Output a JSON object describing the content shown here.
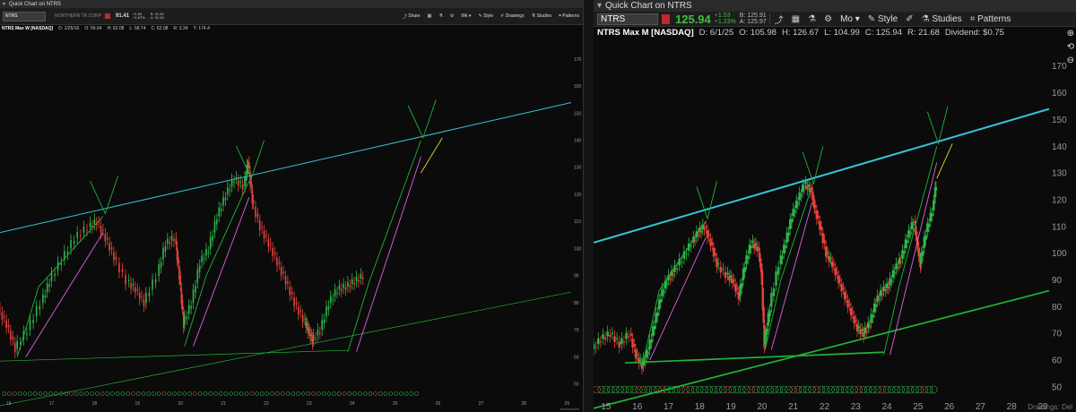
{
  "left": {
    "window_title": "Quick Chart on NTRS",
    "symbol": "NTRS",
    "company": "NORTHERN TR CORP",
    "last_price": "91.41",
    "change_abs": "+1.50",
    "change_pct": "+1.67%",
    "bid": "B: 90.56",
    "ask": "A: 92.38",
    "toolbar": {
      "share": "Share",
      "period": "Wk",
      "style": "Style",
      "drawings": "Drawings",
      "studies": "Studies",
      "patterns": "Patterns"
    },
    "info": {
      "sym": "NTRS Max W [NASDAQ]",
      "date": "D: 1/25/16",
      "open": "O: 59.94",
      "high": "H: 62.08",
      "low": "L: 58.74",
      "close": "C: 62.08",
      "range": "R: 3.34",
      "extra": "Y: 174.4"
    },
    "price_box": "174.4",
    "footer": "thinkorswim",
    "chart_data": {
      "type": "line",
      "x_ticks": [
        "16",
        "17",
        "18",
        "19",
        "20",
        "21",
        "22",
        "23",
        "24",
        "25",
        "26",
        "27",
        "28",
        "29"
      ],
      "y_ticks": [
        "50",
        "60",
        "70",
        "80",
        "90",
        "100",
        "110",
        "120",
        "130",
        "140",
        "150",
        "160",
        "170"
      ],
      "ylim": [
        45,
        178
      ],
      "xlim": [
        15.8,
        29.1
      ],
      "grid": false,
      "series": [
        {
          "values": [
            [
              15.8,
              78
            ],
            [
              16.0,
              72
            ],
            [
              16.2,
              63
            ],
            [
              16.5,
              70
            ],
            [
              16.8,
              80
            ],
            [
              17.0,
              88
            ],
            [
              17.3,
              96
            ],
            [
              17.6,
              104
            ],
            [
              17.9,
              108
            ],
            [
              18.1,
              110
            ],
            [
              18.3,
              104
            ],
            [
              18.5,
              97
            ],
            [
              18.8,
              88
            ],
            [
              19.0,
              85
            ],
            [
              19.2,
              80
            ],
            [
              19.5,
              90
            ],
            [
              19.7,
              102
            ],
            [
              19.9,
              104
            ],
            [
              20.0,
              90
            ],
            [
              20.1,
              72
            ],
            [
              20.3,
              80
            ],
            [
              20.5,
              95
            ],
            [
              20.7,
              100
            ],
            [
              20.9,
              112
            ],
            [
              21.1,
              120
            ],
            [
              21.3,
              126
            ],
            [
              21.5,
              123
            ],
            [
              21.6,
              132
            ],
            [
              21.7,
              118
            ],
            [
              21.9,
              108
            ],
            [
              22.1,
              102
            ],
            [
              22.3,
              95
            ],
            [
              22.5,
              88
            ],
            [
              22.7,
              80
            ],
            [
              22.9,
              74
            ],
            [
              23.0,
              70
            ],
            [
              23.1,
              66
            ],
            [
              23.3,
              70
            ],
            [
              23.5,
              80
            ],
            [
              23.7,
              85
            ],
            [
              23.9,
              86
            ],
            [
              24.1,
              88
            ],
            [
              24.3,
              90
            ]
          ]
        }
      ],
      "top_channel": {
        "x": [
          15.8,
          29.1
        ],
        "y": [
          106,
          154
        ]
      },
      "bottom_channel": {
        "x": [
          15.8,
          29.1
        ],
        "y": [
          42,
          84
        ]
      },
      "flat_support": {
        "x": [
          15.8,
          23.9
        ],
        "y": [
          58.5,
          62.5
        ]
      }
    }
  },
  "right": {
    "window_title": "Quick Chart on NTRS",
    "symbol": "NTRS",
    "last_price": "125.94",
    "change_abs": "+1.53",
    "change_pct": "+1.23%",
    "bid": "B: 125.91",
    "ask": "A: 125.97",
    "toolbar": {
      "period": "Mo",
      "style": "Style",
      "studies": "Studies",
      "patterns": "Patterns"
    },
    "info": {
      "sym": "NTRS Max M [NASDAQ]",
      "date": "D: 6/1/25",
      "open": "O: 105.98",
      "high": "H: 126.67",
      "low": "L: 104.99",
      "close": "C: 125.94",
      "range": "R: 21.68",
      "dividend": "Dividend: $0.75"
    },
    "footer": "Drawings: Del",
    "chart_data": {
      "type": "line",
      "x_ticks": [
        "15",
        "16",
        "17",
        "18",
        "19",
        "20",
        "21",
        "22",
        "23",
        "24",
        "25",
        "26",
        "27",
        "28",
        "29"
      ],
      "y_ticks": [
        "50",
        "60",
        "70",
        "80",
        "90",
        "100",
        "110",
        "120",
        "130",
        "140",
        "150",
        "160",
        "170"
      ],
      "ylim": [
        46,
        178
      ],
      "xlim": [
        14.6,
        29.2
      ],
      "grid": false,
      "series": [
        {
          "values": [
            [
              14.6,
              64
            ],
            [
              14.9,
              68
            ],
            [
              15.2,
              70
            ],
            [
              15.5,
              66
            ],
            [
              15.8,
              70
            ],
            [
              16.0,
              62
            ],
            [
              16.2,
              58
            ],
            [
              16.4,
              64
            ],
            [
              16.6,
              74
            ],
            [
              16.8,
              84
            ],
            [
              17.0,
              90
            ],
            [
              17.2,
              93
            ],
            [
              17.5,
              98
            ],
            [
              17.8,
              104
            ],
            [
              18.0,
              108
            ],
            [
              18.2,
              110
            ],
            [
              18.4,
              104
            ],
            [
              18.6,
              96
            ],
            [
              18.9,
              92
            ],
            [
              19.1,
              90
            ],
            [
              19.3,
              84
            ],
            [
              19.5,
              96
            ],
            [
              19.7,
              104
            ],
            [
              19.9,
              102
            ],
            [
              20.0,
              94
            ],
            [
              20.1,
              66
            ],
            [
              20.3,
              80
            ],
            [
              20.6,
              96
            ],
            [
              20.8,
              104
            ],
            [
              21.0,
              114
            ],
            [
              21.2,
              120
            ],
            [
              21.4,
              126
            ],
            [
              21.6,
              124
            ],
            [
              21.7,
              118
            ],
            [
              21.9,
              110
            ],
            [
              22.1,
              100
            ],
            [
              22.3,
              96
            ],
            [
              22.5,
              90
            ],
            [
              22.7,
              84
            ],
            [
              22.9,
              78
            ],
            [
              23.1,
              72
            ],
            [
              23.3,
              70
            ],
            [
              23.5,
              74
            ],
            [
              23.7,
              82
            ],
            [
              23.9,
              86
            ],
            [
              24.1,
              88
            ],
            [
              24.3,
              94
            ],
            [
              24.5,
              98
            ],
            [
              24.7,
              106
            ],
            [
              24.9,
              112
            ],
            [
              25.0,
              104
            ],
            [
              25.1,
              96
            ],
            [
              25.3,
              108
            ],
            [
              25.5,
              116
            ],
            [
              25.6,
              126
            ]
          ]
        }
      ],
      "top_channel": {
        "x": [
          14.6,
          29.2
        ],
        "y": [
          104,
          154
        ]
      },
      "bottom_channel": {
        "x": [
          14.6,
          29.2
        ],
        "y": [
          42,
          86
        ]
      },
      "flat_support": {
        "x": [
          15.6,
          23.9
        ],
        "y": [
          59,
          63
        ]
      }
    }
  },
  "colors": {
    "up": "#2fb84a",
    "down": "#e8433c",
    "cyan_channel": "#38c3d6",
    "green_channel": "#1fb43a",
    "magenta": "#e05fe0",
    "yellow": "#e0d23a",
    "axis_text": "#9a9a9a"
  }
}
